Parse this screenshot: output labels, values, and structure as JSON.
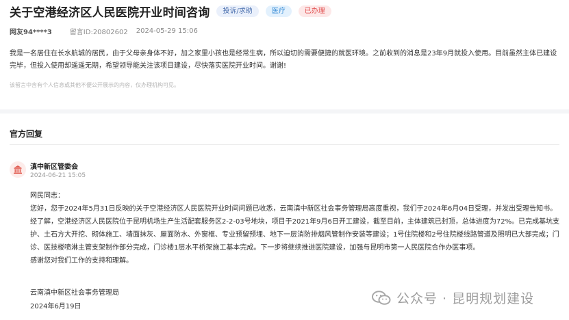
{
  "question": {
    "title": "关于空港经济区人民医院开业时间咨询",
    "tags": [
      "投诉/求助",
      "医疗",
      "已办理"
    ],
    "user": "网友94****3",
    "message_id": "留言ID:20802602",
    "time": "2024-05-29 15:06",
    "content": "我是一名居住在长水航城的居民，由于父母亲身体不好，加之家里小孩也是经常生病，所以迫切的需要便捷的就医环境。之前收到的消息是23年9月就投入使用。目前虽然主体已建设完毕，但投入使用却遥遥无期，希望领导能关注该项目建设，尽快落实医院开业时间。谢谢!",
    "privacy_notice": "该留言中含有个人信息或其他不便公开展示的内容，仅办理机构可见。"
  },
  "reply": {
    "heading": "官方回复",
    "org_name": "滇中新区管委会",
    "time": "2024-06-21 15:05",
    "greeting": "网民同志：",
    "paragraph1": "您好，您于2024年5月31日反映的关于空港经济区人民医院开业时间问题已收悉，云南滇中新区社会事务管理局高度重视，我们于2024年6月04日受理，并发出受理告知书。",
    "paragraph2": "经了解，空港经济区人民医院位于昆明机场生产生活配套服务区2-2-03号地块，项目于2021年9月6日开工建设，截至目前，主体建筑已封顶，总体进度为72%。已完成基坑支护、土石方大开挖、砌体施工、墙面抹灰、屋面防水、外窗框、专业预留预埋、地下一层消防排烟风管制作安装等建设；1号住院楼和2号住院楼线路管道及照明已大部完成；门诊、医技楼喷淋主管支架制作部分完成，门诊楼1层水平桥架施工基本完成。下一步将继续推进医院建设，加强与昆明市第一人民医院合作办医事项。",
    "paragraph3": "感谢您对我们工作的支持和理解。",
    "sign_org": "云南滇中新区社会事务管理局",
    "sign_date": "2024年6月19日"
  },
  "watermark": {
    "text": "公众号 · 昆明规划建设",
    "icon": "wechat-icon"
  },
  "colors": {
    "accent_red": "#e04a4a",
    "tag_blue": "#3d8fd8"
  }
}
